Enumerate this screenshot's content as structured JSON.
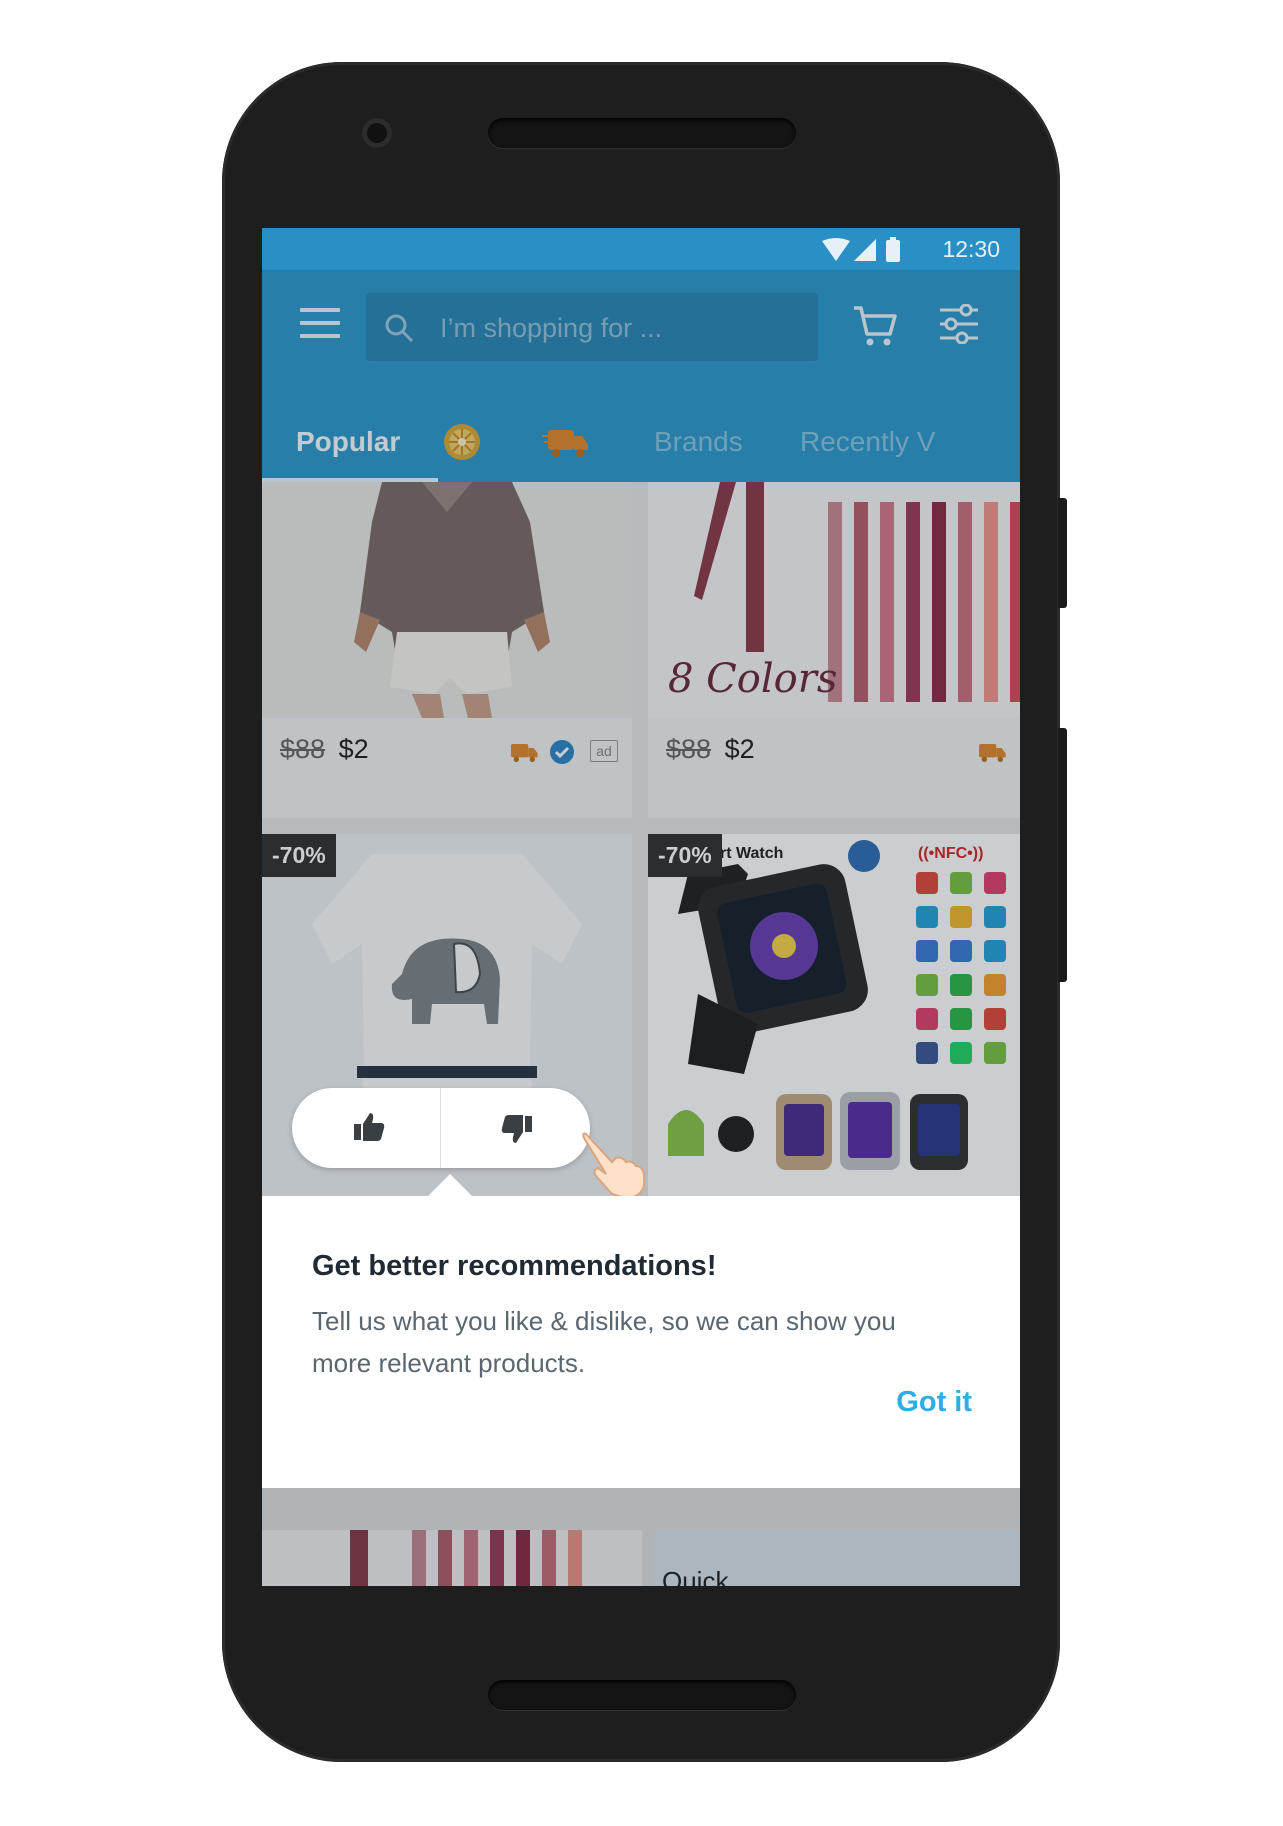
{
  "status_bar": {
    "time": "12:30"
  },
  "app_bar": {
    "search_placeholder": "I’m shopping for ..."
  },
  "tabs": [
    {
      "label": "Popular",
      "active": true
    },
    {
      "label": "",
      "icon": "daily-wheel-icon"
    },
    {
      "label": "",
      "icon": "express-shipping-icon"
    },
    {
      "label": "Brands"
    },
    {
      "label": "Recently V"
    }
  ],
  "products": [
    {
      "old_price": "$88",
      "price": "$2",
      "ad_label": "ad"
    },
    {
      "old_price": "$88",
      "price": "$2",
      "image_text": "8 Colors"
    },
    {
      "discount": "-70%"
    },
    {
      "discount": "-70%",
      "image_text_1": "rt Watch",
      "image_text_2": "((•NFC•))"
    }
  ],
  "lower_preview": {
    "text": "Quick"
  },
  "tooltip": {
    "title": "Get better recommendations!",
    "body": "Tell us what you like & dislike, so we can show you more relevant products.",
    "button": "Got it"
  },
  "colors": {
    "primary": "#2e9acd",
    "status_bar": "#2a8fc4",
    "accent_button": "#2eaee3",
    "shipping_icon": "#e08a2c"
  }
}
